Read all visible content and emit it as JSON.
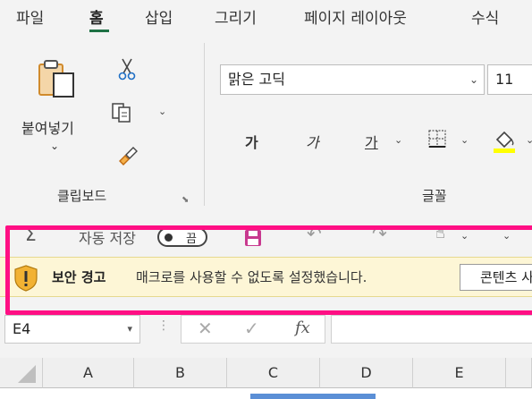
{
  "tabs": [
    {
      "label": "파일"
    },
    {
      "label": "홈"
    },
    {
      "label": "삽입"
    },
    {
      "label": "그리기"
    },
    {
      "label": "페이지 레이아웃"
    },
    {
      "label": "수식"
    }
  ],
  "ribbon": {
    "clipboard": {
      "paste_label": "붙여넣기",
      "group_label": "클립보드"
    },
    "font": {
      "font_name": "맑은 고딕",
      "font_size": "11",
      "bold": "가",
      "italic": "가",
      "underline": "가",
      "group_label": "글꼴",
      "fill_color": "#ffff00"
    }
  },
  "qat": {
    "autosave_label": "자동 저장",
    "toggle_state": "끔"
  },
  "warning": {
    "title": "보안 경고",
    "message": "매크로를 사용할 수 없도록 설정했습니다.",
    "button_label": "콘텐츠 사용"
  },
  "formula_bar": {
    "name_box": "E4",
    "fx_label": "fx",
    "cancel_symbol": "✕",
    "enter_symbol": "✓"
  },
  "grid": {
    "columns": [
      "A",
      "B",
      "C",
      "D",
      "E"
    ]
  },
  "colors": {
    "accent": "#1e7145",
    "highlight": "#ff0f84",
    "warning_bg": "#fdf6d6",
    "warning_icon": "#f2b233"
  }
}
